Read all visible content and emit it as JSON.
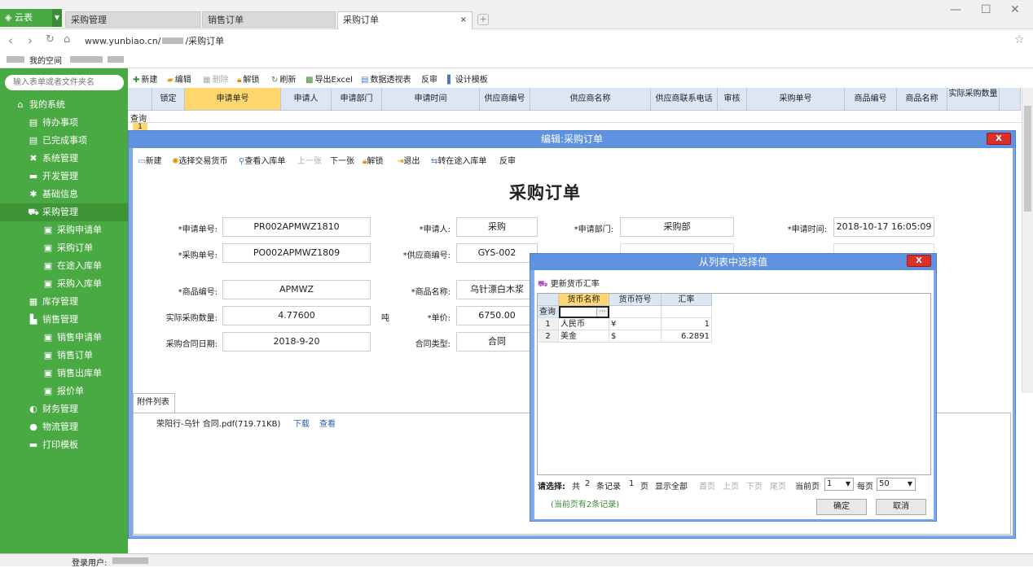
{
  "browser": {
    "logo": "云表",
    "tabs": [
      "采购管理",
      "销售订单",
      "采购订单"
    ],
    "close": "×",
    "url_prefix": "www.yunbiao.cn/",
    "url_suffix": "/采购订单",
    "bookmark": "我的空间"
  },
  "sidebar": {
    "search_placeholder": "输入表单或者文件夹名",
    "items": [
      {
        "label": "我的系统",
        "icon": "home-icon"
      },
      {
        "label": "待办事项",
        "icon": "list-icon"
      },
      {
        "label": "已完成事项",
        "icon": "list-icon"
      },
      {
        "label": "系统管理",
        "icon": "tools-icon"
      },
      {
        "label": "开发管理",
        "icon": "folder-icon"
      },
      {
        "label": "基础信息",
        "icon": "gear-icon"
      },
      {
        "label": "采购管理",
        "icon": "cart-icon"
      },
      {
        "label": "采购申请单",
        "icon": "doc-icon"
      },
      {
        "label": "采购订单",
        "icon": "doc-icon"
      },
      {
        "label": "在途入库单",
        "icon": "doc-icon"
      },
      {
        "label": "采购入库单",
        "icon": "doc-icon"
      },
      {
        "label": "库存管理",
        "icon": "grid-icon"
      },
      {
        "label": "销售管理",
        "icon": "chart-icon"
      },
      {
        "label": "销售申请单",
        "icon": "doc-icon"
      },
      {
        "label": "销售订单",
        "icon": "doc-icon"
      },
      {
        "label": "销售出库单",
        "icon": "doc-icon"
      },
      {
        "label": "报价单",
        "icon": "doc-icon"
      },
      {
        "label": "财务管理",
        "icon": "money-icon"
      },
      {
        "label": "物流管理",
        "icon": "globe-icon"
      },
      {
        "label": "打印模板",
        "icon": "folder-icon"
      }
    ]
  },
  "toolbar": {
    "new": "新建",
    "edit": "编辑",
    "delete": "删除",
    "unlock": "解锁",
    "refresh": "刷新",
    "export": "导出Excel",
    "pivot": "数据透视表",
    "review": "反审",
    "design": "设计模板"
  },
  "table": {
    "headers": [
      "锁定",
      "申请单号",
      "申请人",
      "申请部门",
      "申请时间",
      "供应商编号",
      "供应商名称",
      "供应商联系电话",
      "审核",
      "采购单号",
      "商品编号",
      "商品名称",
      "实际采购数量"
    ],
    "query": "查询",
    "row_num": "1"
  },
  "edit_dialog": {
    "title": "编辑:采购订单",
    "close": "X",
    "toolbar": {
      "new": "新建",
      "choose_currency": "选择交易货币",
      "view_stock_in": "查看入库单",
      "prev": "上一张",
      "next": "下一张",
      "unlock": "解锁",
      "exit": "退出",
      "to_transit": "转在途入库单",
      "review": "反审"
    },
    "heading": "采购订单",
    "fields": {
      "req_no_label": "*申请单号:",
      "req_no": "PR002APMWZ1810",
      "applicant_label": "*申请人:",
      "applicant": "采购",
      "dept_label": "*申请部门:",
      "dept": "采购部",
      "time_label": "*申请时间:",
      "time": "2018-10-17 16:05:09",
      "po_no_label": "*采购单号:",
      "po_no": "PO002APMWZ1809",
      "supplier_no_label": "*供应商编号:",
      "supplier_no": "GYS-002",
      "product_no_label": "*商品编号:",
      "product_no": "APMWZ",
      "product_name_label": "*商品名称:",
      "product_name": "乌针漂白木浆",
      "qty_label": "实际采购数量:",
      "qty": "4.77600",
      "unit": "吨",
      "price_label": "*单价:",
      "price": "6750.00",
      "contract_date_label": "采购合同日期:",
      "contract_date": "2018-9-20",
      "contract_type_label": "合同类型:",
      "contract_type": "合同"
    },
    "attachments_tab": "附件列表",
    "attachment": {
      "name": "荣阳行-乌针 合同.pdf(719.71KB)",
      "download": "下载",
      "view": "查看"
    }
  },
  "currency_dialog": {
    "title": "从列表中选择值",
    "close": "X",
    "update_rates": "更新货币汇率",
    "columns": [
      "货币名称",
      "货币符号",
      "汇率"
    ],
    "query": "查询",
    "rows": [
      {
        "num": "1",
        "name": "人民币",
        "symbol": "¥",
        "rate": "1"
      },
      {
        "num": "2",
        "name": "美金",
        "symbol": "$",
        "rate": "6.2891"
      }
    ],
    "pager": {
      "select": "请选择:",
      "total": "共",
      "count": "2",
      "records": "条记录",
      "pages": "1",
      "page_unit": "页",
      "show_all": "显示全部",
      "first": "首页",
      "prev": "上页",
      "next": "下页",
      "last": "尾页",
      "current_label": "当前页",
      "current": "1",
      "per_page_label": "每页",
      "per_page": "50"
    },
    "note": "(当前页有2条记录)",
    "ok": "确定",
    "cancel": "取消"
  },
  "status": {
    "user_label": "登录用户:"
  }
}
